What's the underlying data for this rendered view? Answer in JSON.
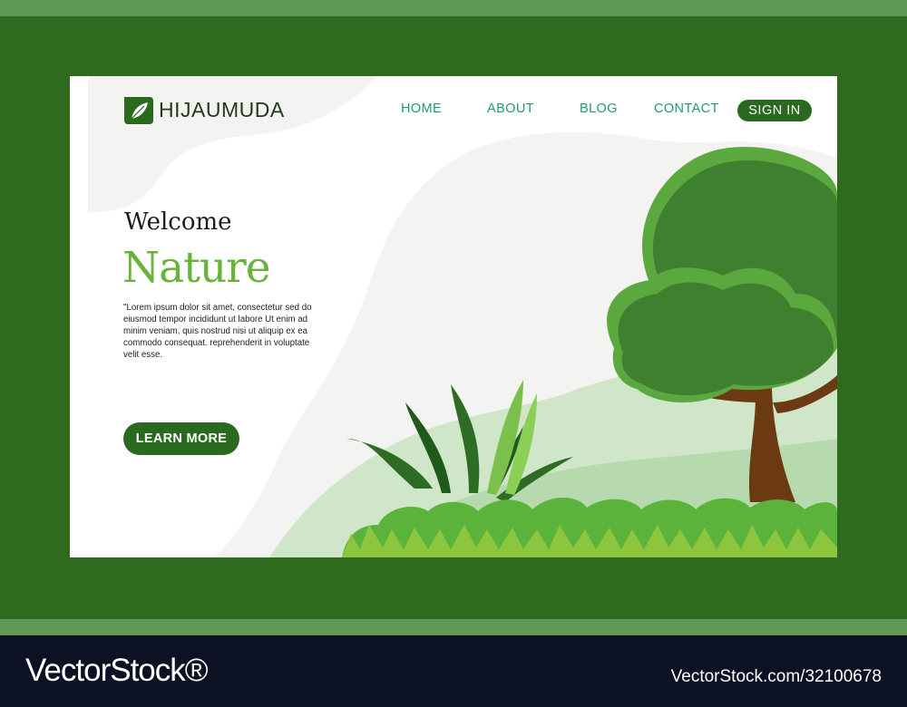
{
  "brand": {
    "name": "HIJAUMUDA",
    "icon": "leaf-icon"
  },
  "nav": {
    "home": "HOME",
    "about": "ABOUT",
    "blog": "BLOG",
    "contact": "CONTACT",
    "sign_in": "SIGN IN"
  },
  "hero": {
    "welcome": "Welcome",
    "title": "Nature",
    "body": "\"Lorem ipsum dolor sit amet, consectetur sed do eiusmod tempor incididunt ut labore Ut enim ad minim veniam, quis nostrud nisi ut aliquip ex ea commodo consequat. reprehenderit in voluptate velit esse.",
    "cta": "LEARN MORE"
  },
  "watermark": {
    "brand": "VectorStock®",
    "id": "VectorStock.com/32100678"
  },
  "colors": {
    "frame": "#2f6b1f",
    "accent_green": "#6ab33a",
    "nav_teal": "#1f9a74",
    "button_green": "#2a6a1f",
    "footer": "#0c1224"
  }
}
